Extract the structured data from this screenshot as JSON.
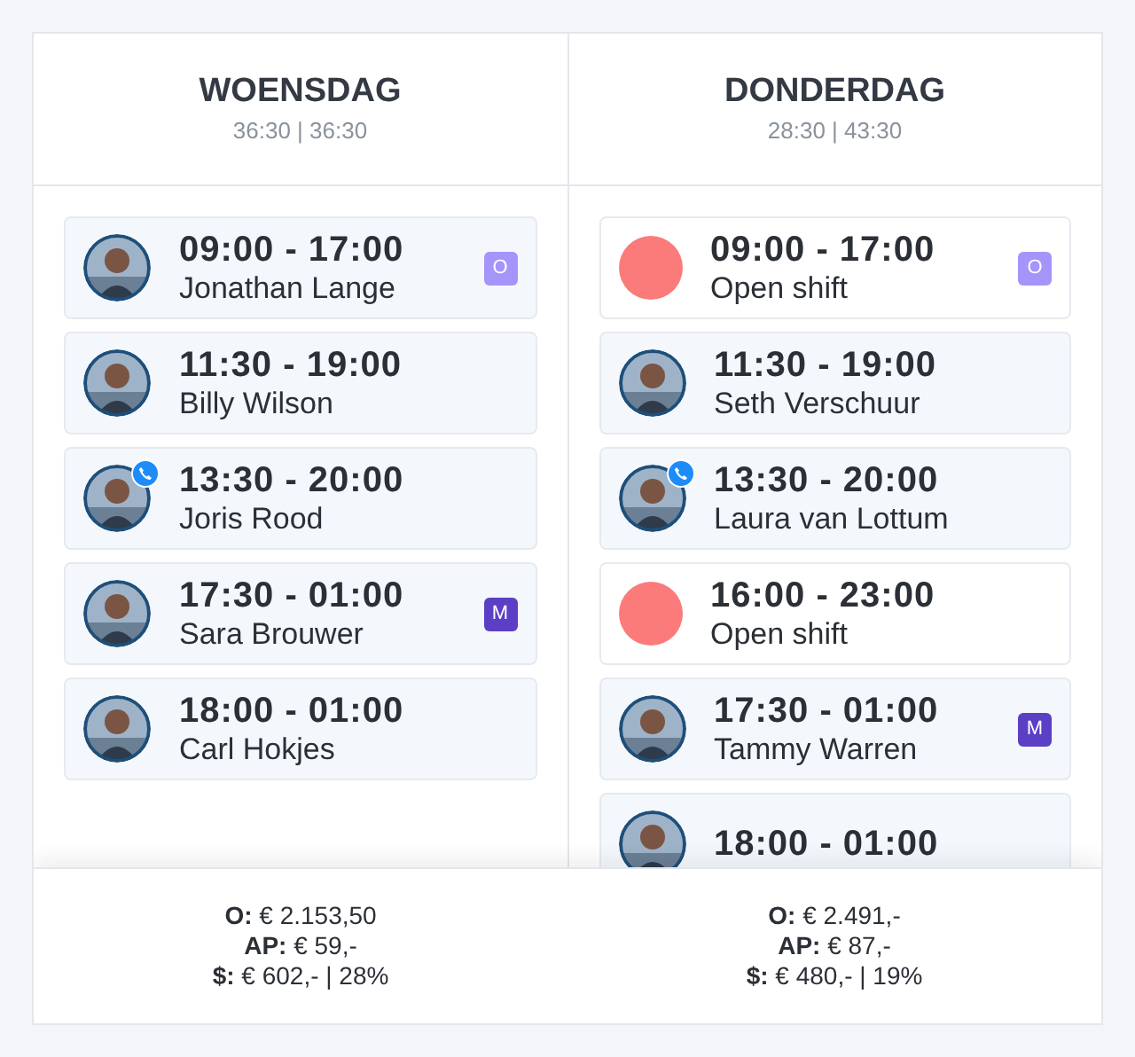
{
  "days": [
    {
      "title": "WOENSDAG",
      "hours": "36:30 | 36:30",
      "shifts": [
        {
          "kind": "person",
          "time": "09:00 - 17:00",
          "name": "Jonathan Lange",
          "on_call": false,
          "badge": {
            "label": "O",
            "color": "#a594f9"
          }
        },
        {
          "kind": "person",
          "time": "11:30 - 19:00",
          "name": "Billy Wilson",
          "on_call": false
        },
        {
          "kind": "person",
          "time": "13:30 - 20:00",
          "name": "Joris Rood",
          "on_call": true
        },
        {
          "kind": "person",
          "time": "17:30 - 01:00",
          "name": "Sara Brouwer",
          "on_call": false,
          "badge": {
            "label": "M",
            "color": "#5b3fc4"
          }
        },
        {
          "kind": "person",
          "time": "18:00 - 01:00",
          "name": "Carl Hokjes",
          "on_call": false
        }
      ],
      "totals": [
        "**O:** € 2.153,50",
        "**AP:** € 59,-",
        "**$:** € 602,- | 28%"
      ]
    },
    {
      "title": "DONDERDAG",
      "hours": "28:30 | 43:30",
      "shifts": [
        {
          "kind": "open",
          "time": "09:00 - 17:00",
          "name": "Open shift",
          "badge": {
            "label": "O",
            "color": "#a594f9"
          }
        },
        {
          "kind": "person",
          "time": "11:30 - 19:00",
          "name": "Seth Verschuur",
          "on_call": false
        },
        {
          "kind": "person",
          "time": "13:30 - 20:00",
          "name": "Laura van Lottum",
          "on_call": true
        },
        {
          "kind": "open",
          "time": "16:00 - 23:00",
          "name": "Open shift"
        },
        {
          "kind": "person",
          "time": "17:30 - 01:00",
          "name": "Tammy Warren",
          "on_call": false,
          "badge": {
            "label": "M",
            "color": "#5b3fc4"
          }
        },
        {
          "kind": "person",
          "time": "18:00 - 01:00",
          "on_call": false
        }
      ],
      "totals": [
        "**O:** € 2.491,-",
        "**AP:** € 87,-",
        "**$:** € 480,- | 19%"
      ]
    }
  ]
}
